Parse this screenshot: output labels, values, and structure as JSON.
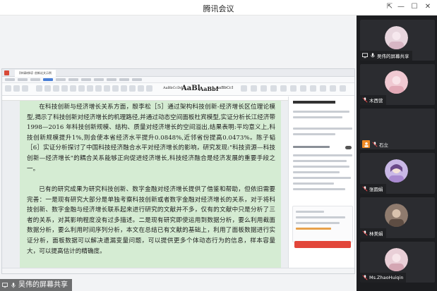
{
  "window": {
    "title": "腾讯会议",
    "controls": {
      "pin": "⇱",
      "minimize": "—",
      "maximize": "☐",
      "close": "✕"
    }
  },
  "share": {
    "label": "吴伟的屏幕共享"
  },
  "document": {
    "tab_title": "【申请材料】创新论文示例",
    "ribbon_styles": [
      "AaBbCcDd",
      "AaBl",
      "AaBbI",
      "AaBbCcI"
    ],
    "paragraphs": [
      "在科技创新与经济增长关系方面，殷李松［5］通过架构科技创新-经济增长区位理论模型,揭示了科技创新对经济增长的机理路径,并通过动态空间面板杜宾模型,实证分析长江经济带 1998—2016 年科技创新规模、结构、质量对经济增长的空间溢出,结果表明:平均意义上,科技创新规模提升1%,则会使本省经济水平提升0.0848%,近邻省份提高0.0473%。陈子韬［6］实证分析探讨了中国科技经济融合水平对经济增长的影响，研究发现:\"科技资源—科技创新—经济增长\"的耦合关系能够正向促进经济增长,科技经济融合是经济发展的重要手段之一。",
      "已有的研究成果为研究科技创新、数字金融对经济增长提供了借鉴和帮助，但依旧需要完善：一是现有研究大部分是单独考察科技创新或者数字金融对经济增长的关系，对于将科技创新、数字金融与经济增长联系起来进行研究的文献并不多，仅有的文献中只是分析了三者的关系，对其影响程度没有过多描述。二是现有研究即使运用到数据分析，要么利用截面数据分析，要么利用时间序列分析，本文在总结已有文献的基础上，利用了面板数据进行实证分析，面板数据可以解决遗漏变量问题，可以提供更多个体动态行为的信息，样本容量大，可以提高估计的精确度。"
    ]
  },
  "participants": [
    {
      "name": "吴伟的屏幕共享",
      "avatar_color": "#e8d6de",
      "mic": "on"
    },
    {
      "name": "木西营",
      "avatar_color": "#f0c9d2",
      "mic": "muted"
    },
    {
      "name": "石立",
      "avatar_color": "#f08a24",
      "mic": "muted"
    },
    {
      "name": "张圆娟",
      "avatar_color": "#c9b8e6",
      "mic": "muted"
    },
    {
      "name": "林美娟",
      "avatar_color": "#8f7b6e",
      "mic": "muted"
    },
    {
      "name": "Ms.ZhaoHuiqin",
      "avatar_color": "#e9cfd7",
      "mic": "muted"
    }
  ]
}
